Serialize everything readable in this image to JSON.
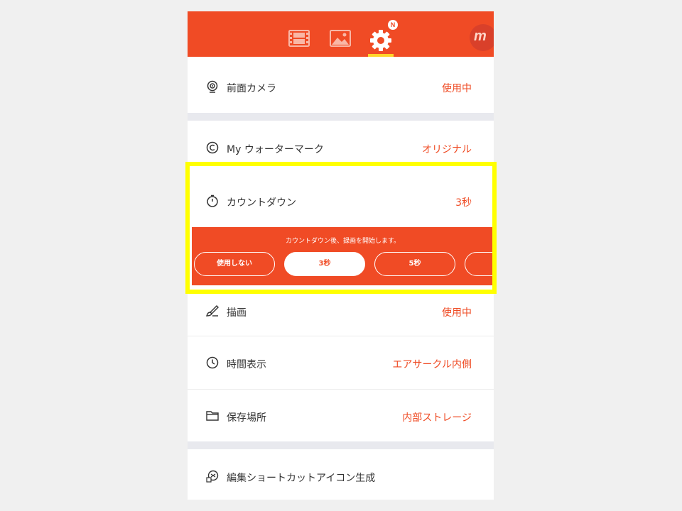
{
  "header": {
    "tabs": [
      {
        "name": "video",
        "icon": "film-icon"
      },
      {
        "name": "photo",
        "icon": "image-icon"
      },
      {
        "name": "settings",
        "icon": "gear-icon",
        "badge": "N",
        "active": true
      }
    ],
    "logo_text": "m"
  },
  "settings": {
    "front_camera": {
      "label": "前面カメラ",
      "value": "使用中",
      "icon": "camera-icon"
    },
    "watermark": {
      "label": "My ウォーターマーク",
      "value": "オリジナル",
      "icon": "copyright-icon"
    },
    "countdown": {
      "label": "カウントダウン",
      "value": "3秒",
      "icon": "stopwatch-icon",
      "message": "カウントダウン後、録画を開始します。",
      "options": [
        "使用しない",
        "3秒",
        "5秒"
      ],
      "selected": "3秒"
    },
    "drawing": {
      "label": "描画",
      "value": "使用中",
      "icon": "brush-icon"
    },
    "time_display": {
      "label": "時間表示",
      "value": "エアサークル内側",
      "icon": "clock-icon"
    },
    "storage": {
      "label": "保存場所",
      "value": "内部ストレージ",
      "icon": "folder-icon"
    },
    "shortcut": {
      "label": "編集ショートカットアイコン生成",
      "icon": "shortcut-icon"
    }
  },
  "colors": {
    "accent": "#f04b25",
    "highlight": "#ffff00",
    "tab_indicator": "#ffd52a",
    "divider": "#e8e9ee"
  }
}
